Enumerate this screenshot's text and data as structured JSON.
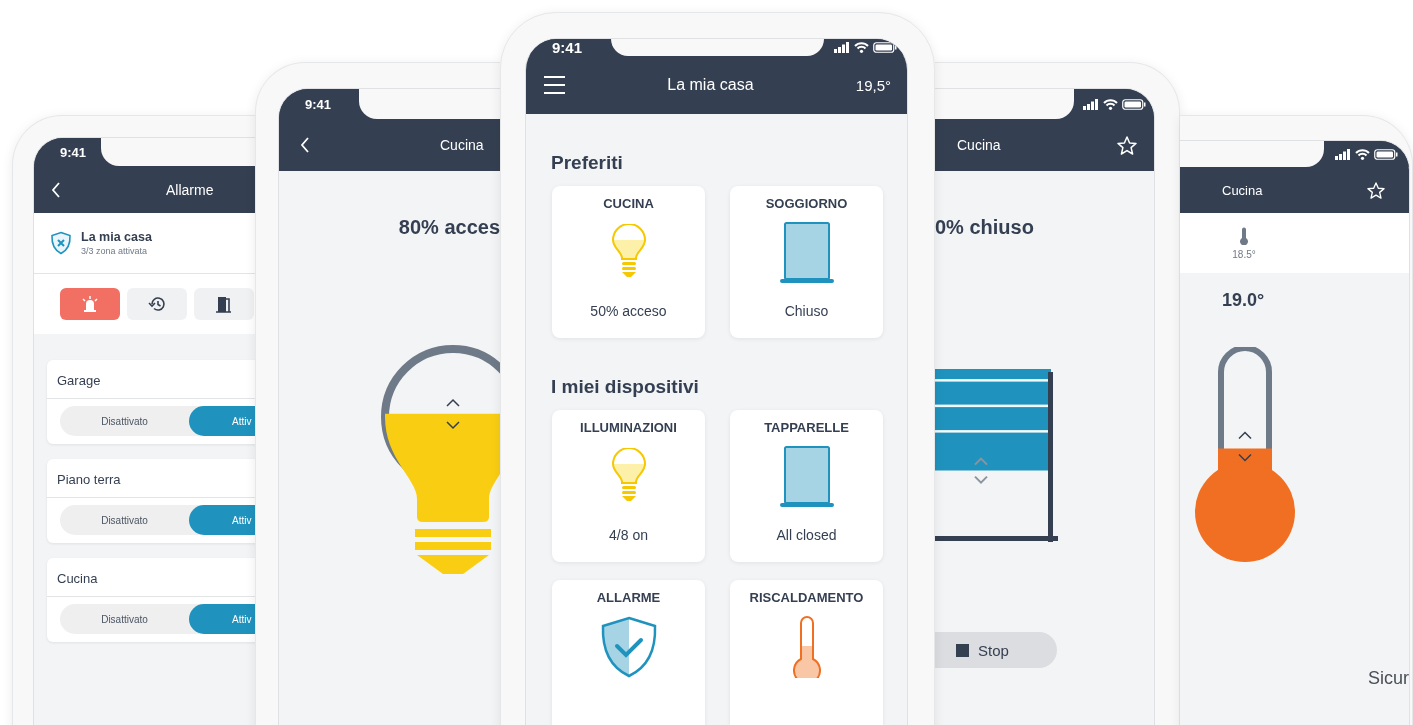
{
  "phones": [
    {
      "kind": "alarm",
      "time": "9:41",
      "title": "Allarme",
      "home": {
        "name": "La mia casa",
        "status": "3/3 zona attivata"
      },
      "modes": [
        {
          "kind": "siren",
          "selected": true
        },
        {
          "kind": "history",
          "selected": false
        },
        {
          "kind": "door",
          "selected": false
        }
      ],
      "zones": [
        {
          "name": "Garage",
          "options": [
            {
              "label": "Disattivato",
              "selected": false
            },
            {
              "label": "Attiv",
              "selected": true
            }
          ]
        },
        {
          "name": "Piano terra",
          "options": [
            {
              "label": "Disattivato",
              "selected": false
            },
            {
              "label": "Attiv",
              "selected": true
            }
          ]
        },
        {
          "name": "Cucina",
          "options": [
            {
              "label": "Disattivato",
              "selected": false
            },
            {
              "label": "Attiv",
              "selected": true
            }
          ]
        }
      ]
    },
    {
      "kind": "light",
      "time": "9:41",
      "title": "Cucina",
      "reading": "80% acces",
      "level": 0.7
    },
    {
      "kind": "home",
      "time": "9:41",
      "title": "La mia casa",
      "temperature": "19,5°",
      "sections": [
        {
          "title": "Preferiti",
          "tiles": [
            {
              "name": "CUCINA",
              "kind": "light",
              "status": "50% acceso"
            },
            {
              "name": "SOGGIORNO",
              "kind": "shutter",
              "status": "Chiuso"
            }
          ]
        },
        {
          "title": "I miei dispositivi",
          "tiles": [
            {
              "name": "ILLUMINAZIONI",
              "kind": "light",
              "status": "4/8 on"
            },
            {
              "name": "TAPPARELLE",
              "kind": "shutter",
              "status": "All closed"
            },
            {
              "name": "ALLARME",
              "kind": "alarm"
            },
            {
              "name": "RISCALDAMENTO",
              "kind": "heating"
            }
          ]
        }
      ]
    },
    {
      "kind": "shutter",
      "title": "Cucina",
      "reading": "0% chiuso",
      "level": 0.58,
      "button": "Stop"
    },
    {
      "kind": "thermostat",
      "title": "Cucina",
      "current": "18.5°",
      "setpoint": "19.0°",
      "level": 0.3,
      "caption": "Sicur"
    }
  ]
}
